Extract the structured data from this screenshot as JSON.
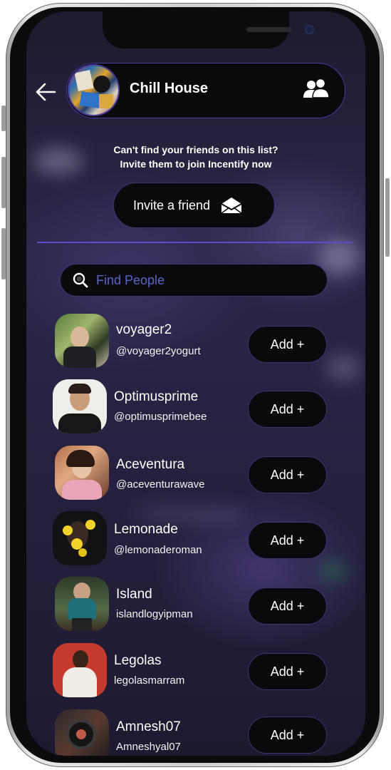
{
  "header": {
    "group_name": "Chill House"
  },
  "invite": {
    "line1": "Can't find your friends on this list?",
    "line2": "Invite them to join Incentify now",
    "button_label": "Invite a friend"
  },
  "search": {
    "placeholder": "Find People"
  },
  "people": [
    {
      "name": "voyager2",
      "handle": "@voyager2yogurt",
      "add_label": "Add +"
    },
    {
      "name": "Optimusprime",
      "handle": "@optimusprimebee",
      "add_label": "Add +"
    },
    {
      "name": "Aceventura",
      "handle": "@aceventurawave",
      "add_label": "Add +"
    },
    {
      "name": "Lemonade",
      "handle": "@lemonaderoman",
      "add_label": "Add +"
    },
    {
      "name": "Island",
      "handle": "islandlogyipman",
      "add_label": "Add +"
    },
    {
      "name": "Legolas",
      "handle": "legolasmarram",
      "add_label": "Add +"
    },
    {
      "name": "Amnesh07",
      "handle": "Amneshyal07",
      "add_label": "Add +"
    }
  ],
  "colors": {
    "accent": "#4b3c9e",
    "placeholder": "#5867c9",
    "pill": "#0a0a0c"
  }
}
